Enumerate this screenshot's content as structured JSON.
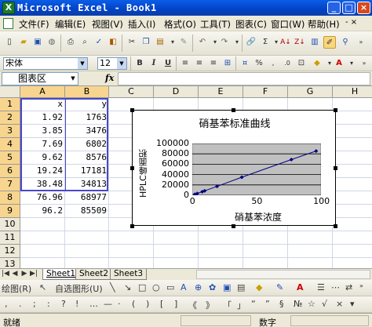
{
  "window": {
    "title": "Microsoft Excel - Book1",
    "app_icon": "excel-icon",
    "buttons": [
      "minimize-icon",
      "maximize-icon",
      "close-icon"
    ]
  },
  "menu": {
    "items": [
      "文件(F)",
      "编辑(E)",
      "视图(V)",
      "插入(I)",
      "格式(O)",
      "工具(T)",
      "图表(C)",
      "窗口(W)",
      "帮助(H)"
    ]
  },
  "format_toolbar": {
    "font_name": "宋体",
    "font_size": "12",
    "bold": "B",
    "italic": "I",
    "underline": "U"
  },
  "formula_bar": {
    "name_box": "图表区",
    "fx": "fx",
    "value": ""
  },
  "grid": {
    "columns": [
      "A",
      "B",
      "C",
      "D",
      "E",
      "F",
      "G",
      "H"
    ],
    "rows": [
      "1",
      "2",
      "3",
      "4",
      "5",
      "6",
      "7",
      "8",
      "9",
      "10",
      "11",
      "12",
      "13"
    ],
    "header_row": {
      "A": "x",
      "B": "y"
    },
    "data": [
      {
        "x": "1.92",
        "y": "1763"
      },
      {
        "x": "3.85",
        "y": "3476"
      },
      {
        "x": "7.69",
        "y": "6802"
      },
      {
        "x": "9.62",
        "y": "8576"
      },
      {
        "x": "19.24",
        "y": "17181"
      },
      {
        "x": "38.48",
        "y": "34813"
      },
      {
        "x": "76.96",
        "y": "68977"
      },
      {
        "x": "96.2",
        "y": "85509"
      }
    ]
  },
  "chart_data": {
    "type": "scatter",
    "title": "硝基苯标准曲线",
    "xlabel": "硝基苯浓度",
    "ylabel": "HPLC峰面积",
    "x": [
      1.92,
      3.85,
      7.69,
      9.62,
      19.24,
      38.48,
      76.96,
      96.2
    ],
    "y": [
      1763,
      3476,
      6802,
      8576,
      17181,
      34813,
      68977,
      85509
    ],
    "xlim": [
      0,
      100
    ],
    "ylim": [
      0,
      100000
    ],
    "x_ticks": [
      "0",
      "50",
      "100"
    ],
    "y_ticks": [
      "0",
      "20000",
      "40000",
      "60000",
      "80000",
      "100000"
    ],
    "grid": true,
    "legend": "none",
    "plot_bg": "#c0c0c0",
    "series_color": "#000080"
  },
  "sheets": {
    "tabs": [
      "Sheet1",
      "Sheet2",
      "Sheet3"
    ],
    "active": "Sheet1"
  },
  "draw_toolbar": {
    "draw_label": "绘图(R)",
    "autoshape_label": "自选图形(U)"
  },
  "status": {
    "ready": "就绪",
    "num": "数字"
  }
}
